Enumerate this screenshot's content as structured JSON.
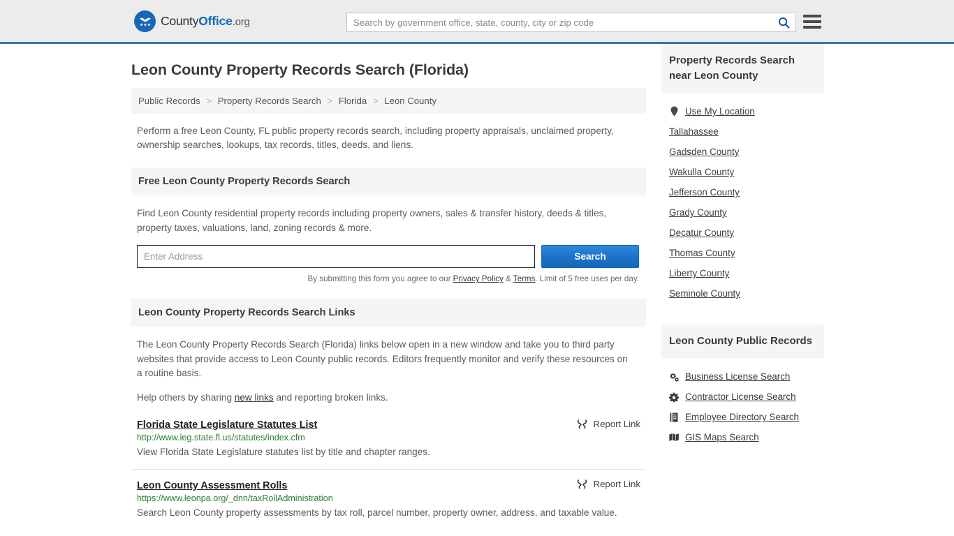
{
  "header": {
    "brand": {
      "part1": "County",
      "part2": "Office",
      "part3": ".org",
      "logo_icon": "eagle-shield-logo"
    },
    "search": {
      "placeholder": "Search by government office, state, county, city or zip code",
      "value": "",
      "icon": "search-icon"
    },
    "menu_icon": "hamburger-menu-icon"
  },
  "page": {
    "title": "Leon County Property Records Search (Florida)",
    "intro": "Perform a free Leon County, FL public property records search, including property appraisals, unclaimed property, ownership searches, lookups, tax records, titles, deeds, and liens."
  },
  "breadcrumb": {
    "items": [
      "Public Records",
      "Property Records Search",
      "Florida",
      "Leon County"
    ],
    "separator": ">"
  },
  "free_search": {
    "heading": "Free Leon County Property Records Search",
    "description": "Find Leon County residential property records including property owners, sales & transfer history, deeds & titles, property taxes, valuations, land, zoning records & more.",
    "input_placeholder": "Enter Address",
    "input_value": "",
    "button_label": "Search",
    "note_prefix": "By submitting this form you agree to our ",
    "note_privacy": "Privacy Policy",
    "note_amp": " & ",
    "note_terms": "Terms",
    "note_suffix": ". Limit of 5 free uses per day."
  },
  "links_section": {
    "heading": "Leon County Property Records Search Links",
    "paragraph": "The Leon County Property Records Search (Florida) links below open in a new window and take you to third party websites that provide access to Leon County public records. Editors frequently monitor and verify these resources on a routine basis.",
    "help_prefix": "Help others by sharing ",
    "help_link": "new links",
    "help_suffix": " and reporting broken links.",
    "report_label": "Report Link",
    "report_icon": "broken-link-icon",
    "items": [
      {
        "title": "Florida State Legislature Statutes List",
        "url": "http://www.leg.state.fl.us/statutes/index.cfm",
        "description": "View Florida State Legislature statutes list by title and chapter ranges."
      },
      {
        "title": "Leon County Assessment Rolls",
        "url": "https://www.leonpa.org/_dnn/taxRollAdministration",
        "description": "Search Leon County property assessments by tax roll, parcel number, property owner, address, and taxable value."
      }
    ]
  },
  "sidebar": {
    "nearby": {
      "heading": "Property Records Search near Leon County",
      "items": [
        {
          "label": "Use My Location",
          "icon": "map-pin-icon"
        },
        {
          "label": "Tallahassee",
          "icon": ""
        },
        {
          "label": "Gadsden County",
          "icon": ""
        },
        {
          "label": "Wakulla County",
          "icon": ""
        },
        {
          "label": "Jefferson County",
          "icon": ""
        },
        {
          "label": "Grady County",
          "icon": ""
        },
        {
          "label": "Decatur County",
          "icon": ""
        },
        {
          "label": "Thomas County",
          "icon": ""
        },
        {
          "label": "Liberty County",
          "icon": ""
        },
        {
          "label": "Seminole County",
          "icon": ""
        }
      ]
    },
    "public_records": {
      "heading": "Leon County Public Records",
      "items": [
        {
          "label": "Business License Search",
          "icon": "cogs-icon"
        },
        {
          "label": "Contractor License Search",
          "icon": "cog-icon"
        },
        {
          "label": "Employee Directory Search",
          "icon": "book-icon"
        },
        {
          "label": "GIS Maps Search",
          "icon": "map-icon"
        }
      ]
    }
  },
  "colors": {
    "brand_blue": "#1668b5",
    "header_bg": "#ececec",
    "header_border": "#3a76a8",
    "panel_bg": "#f5f5f5",
    "url_green": "#2e7d32",
    "text_dark": "#3b3b3b",
    "text_body": "#5a5a5a"
  }
}
